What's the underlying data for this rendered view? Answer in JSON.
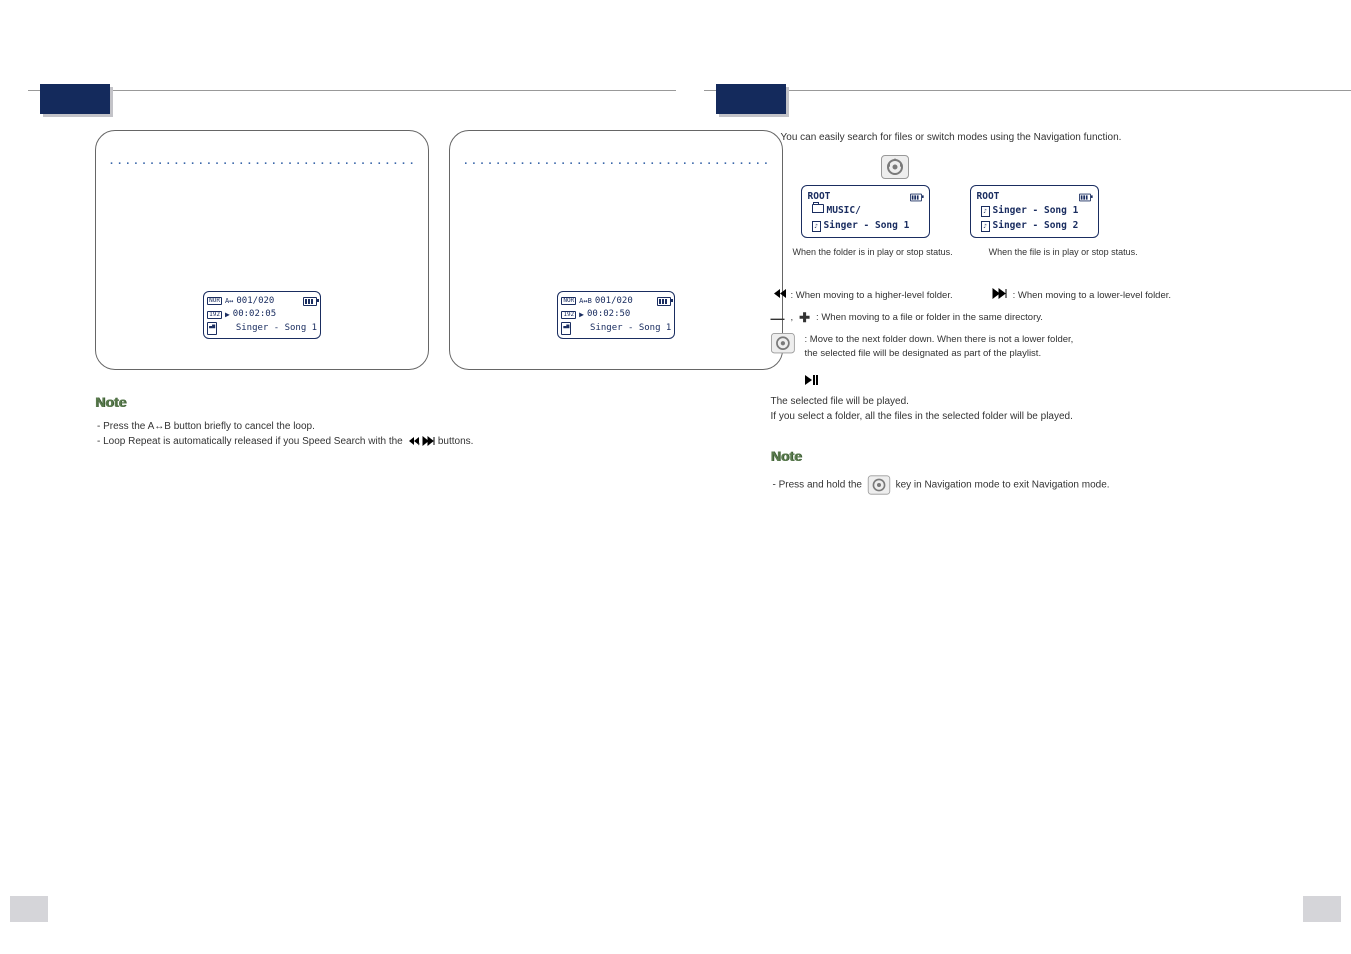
{
  "left": {
    "lcds": [
      {
        "badge_top": "NOR",
        "badge_mid": "192",
        "trk": "001/020",
        "time": "00:02:05",
        "title": "Singer - Song 1",
        "mode": "A"
      },
      {
        "badge_top": "NOR",
        "badge_mid": "192",
        "trk": "001/020",
        "time": "00:02:50",
        "title": "Singer - Song 1",
        "mode": "AB"
      }
    ],
    "note_heading": "Note",
    "note_lines": {
      "l1": "Press the A↔B button briefly to cancel the loop.",
      "l2_a": "Loop Repeat is automatically released if you Speed Search with the ",
      "l2_b": " buttons."
    }
  },
  "right": {
    "intro": "You can easily search for files or switch modes using the Navigation function.",
    "screens": {
      "left": {
        "root": "ROOT",
        "folder": "MUSIC/",
        "file": "Singer - Song 1"
      },
      "right": {
        "root": "ROOT",
        "file1": "Singer - Song 1",
        "file2": "Singer - Song 2"
      }
    },
    "captions": {
      "c1": "When the folder is in play or stop status.",
      "c2": "When the file is in play or stop status."
    },
    "explain": {
      "e1": ": When moving to a higher-level folder.",
      "e2": ": When moving to a lower-level folder.",
      "e3": ":  When moving to a file or folder in the same directory.",
      "e4a": ": Move to the next folder down. When there is not a lower folder,",
      "e4b": "the selected file will be designated as part of the playlist."
    },
    "play_line1": "The selected file will be played.",
    "play_line2": "If you select a folder, all the files in the selected folder will be played.",
    "note_heading": "Note",
    "note_line_a": "Press and hold the ",
    "note_line_b": " key in Navigation mode to exit Navigation mode."
  }
}
